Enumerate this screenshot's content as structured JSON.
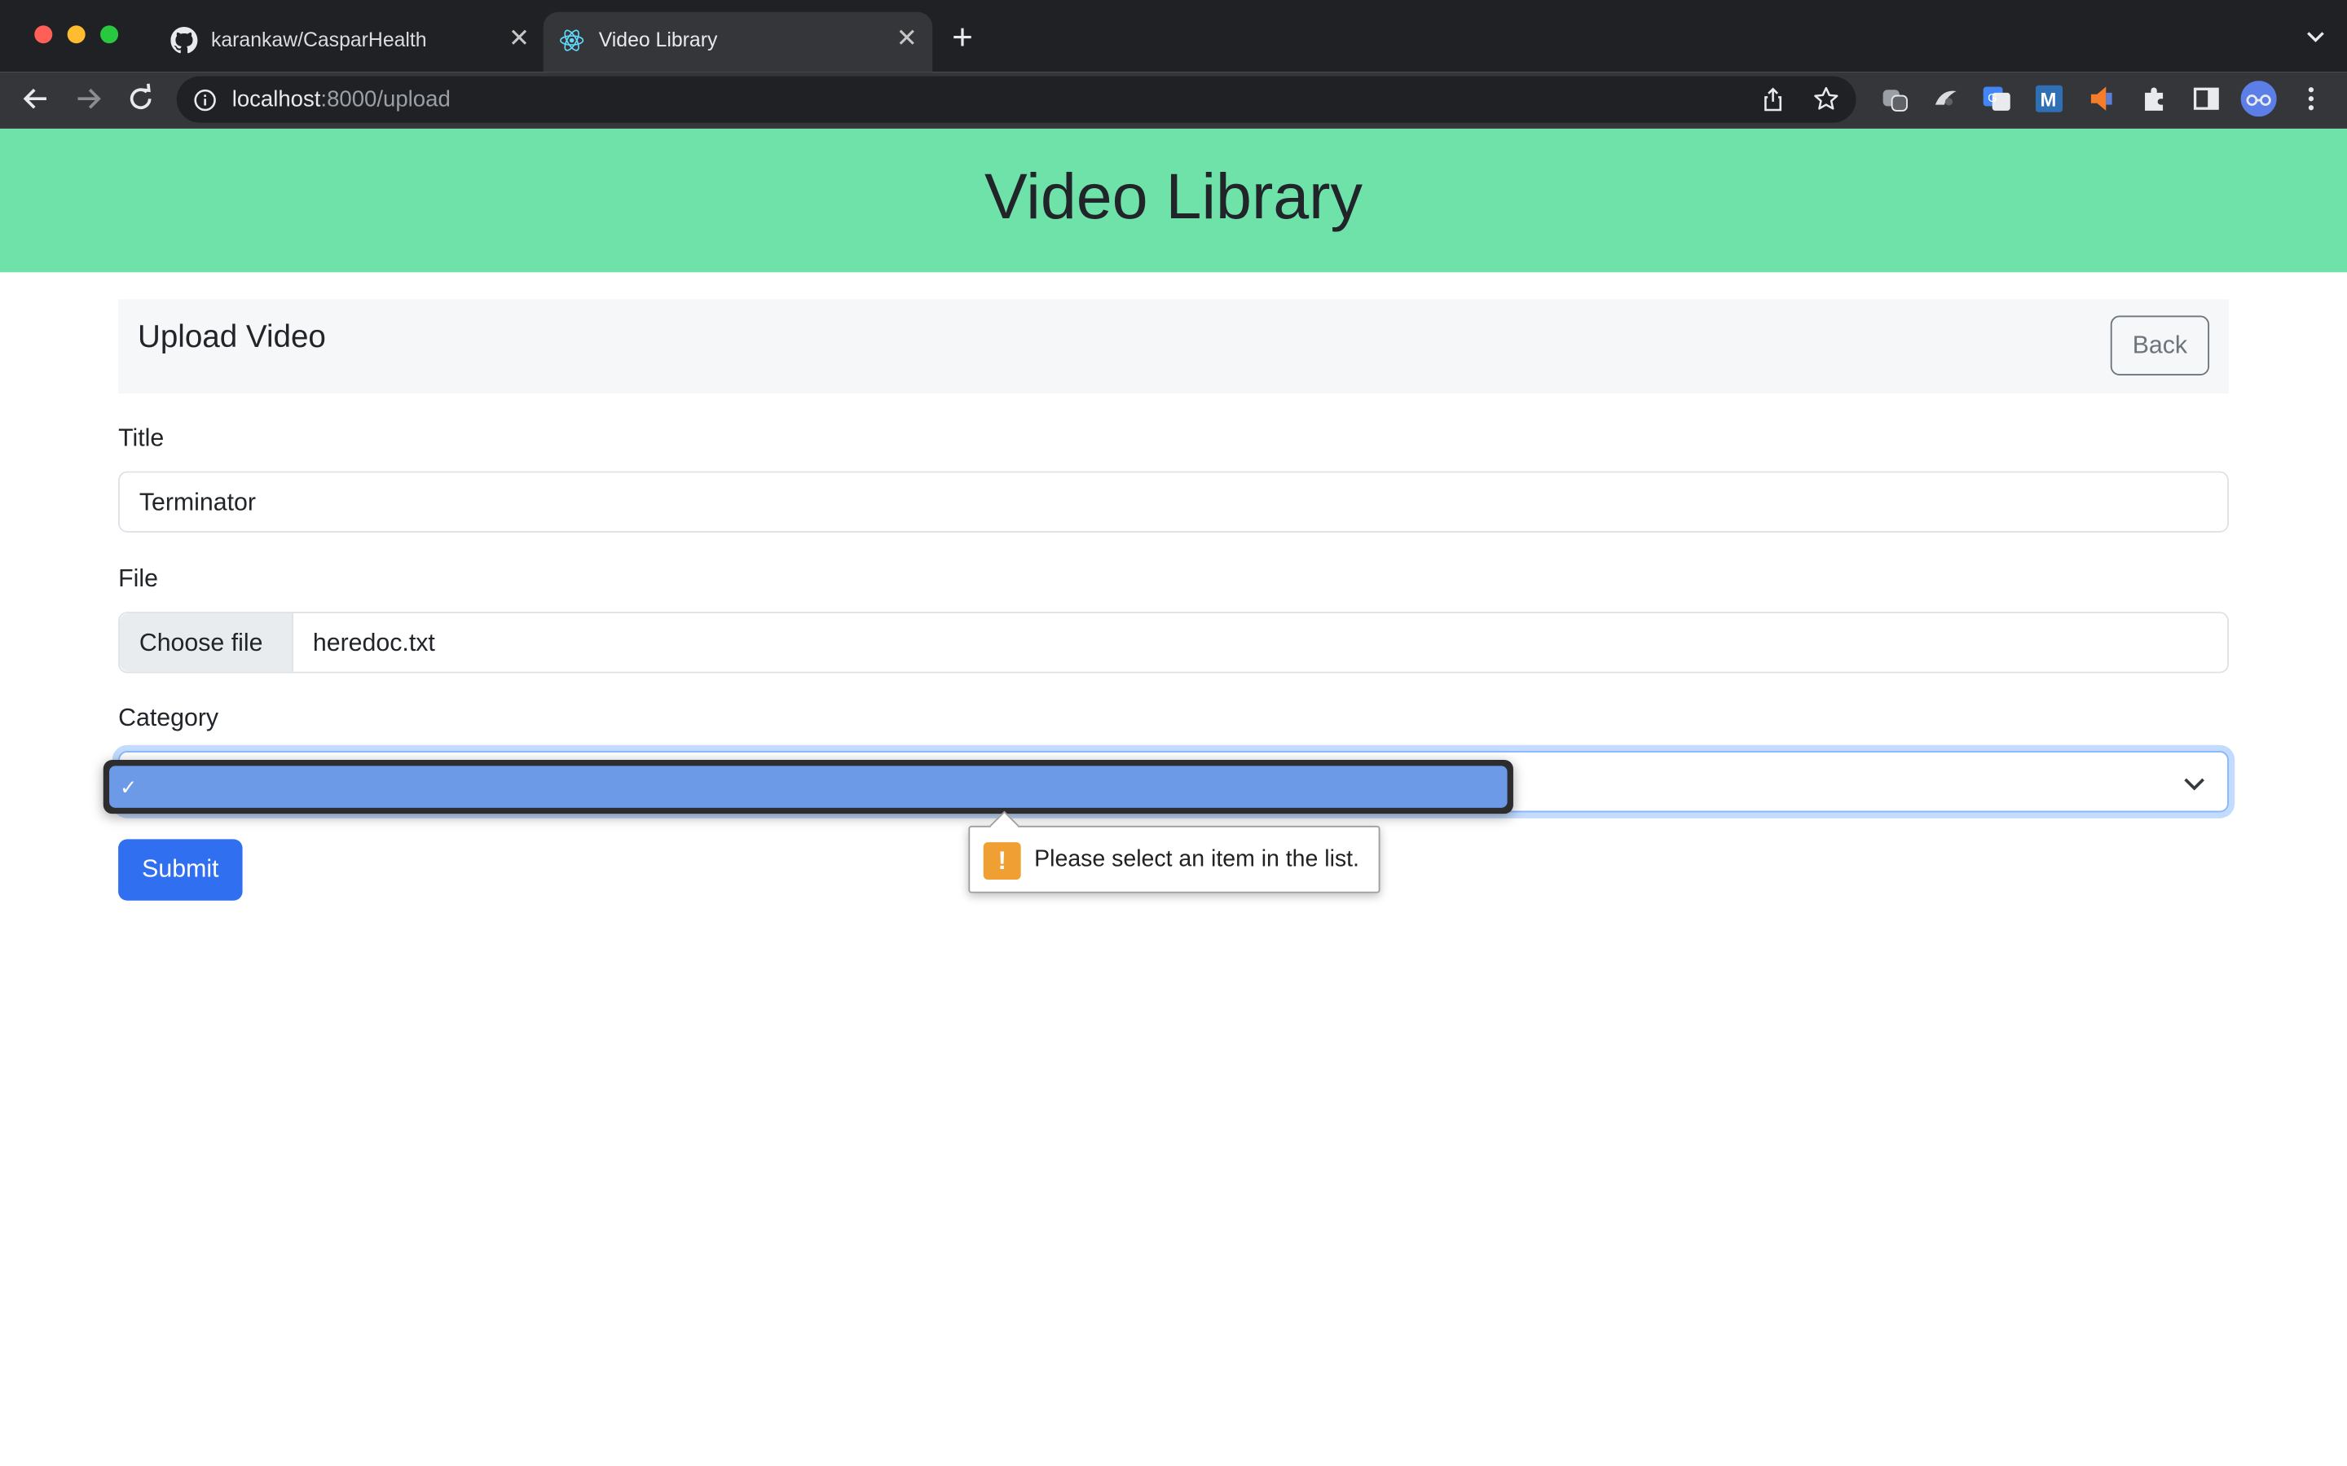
{
  "browser": {
    "tabs": [
      {
        "title": "karankaw/CasparHealth",
        "favicon": "github-icon",
        "active": false
      },
      {
        "title": "Video Library",
        "favicon": "react-icon",
        "active": true
      }
    ],
    "url_host": "localhost",
    "url_rest": ":8000/upload"
  },
  "page": {
    "banner_title": "Video Library",
    "card_title": "Upload Video",
    "back_label": "Back",
    "title_label": "Title",
    "title_value": "Terminator",
    "file_label": "File",
    "file_button": "Choose file",
    "file_name": "heredoc.txt",
    "category_label": "Category",
    "dropdown_check": "✓",
    "submit_label": "Submit",
    "validation_message": "Please select an item in the list.",
    "warning_glyph": "!"
  },
  "colors": {
    "banner": "#6fe2a9",
    "primary": "#2f6ff0",
    "dropdown_highlight": "#6d9ae6",
    "warning": "#f0a032"
  }
}
